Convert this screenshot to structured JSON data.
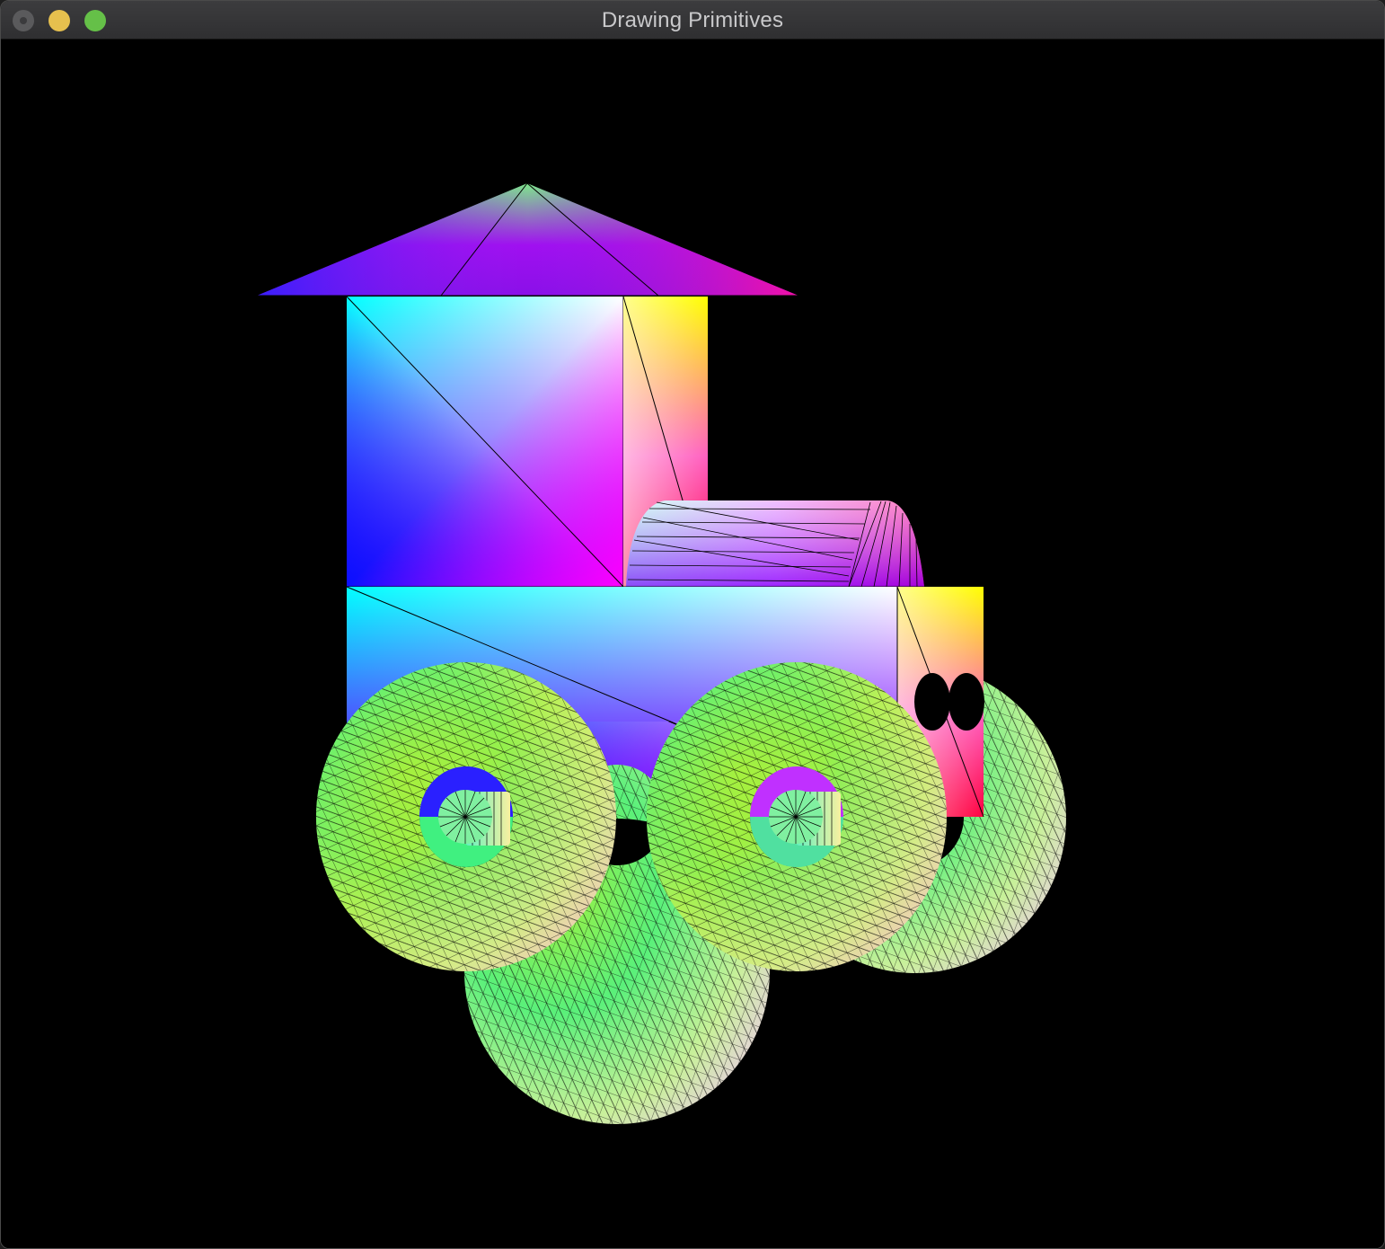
{
  "window": {
    "title": "Drawing Primitives"
  },
  "titlebar": {
    "buttons": [
      {
        "name": "close-button",
        "color": "#5a5a5c"
      },
      {
        "name": "minimize-button",
        "color": "#e6c04e"
      },
      {
        "name": "zoom-button",
        "color": "#65c048"
      }
    ]
  },
  "scene": {
    "background": "#000000",
    "objects": [
      "roof-pyramid",
      "cabin-cube",
      "body-cube",
      "boiler-cylinder",
      "wheel-torus",
      "axle-cylinder",
      "headlight"
    ]
  }
}
